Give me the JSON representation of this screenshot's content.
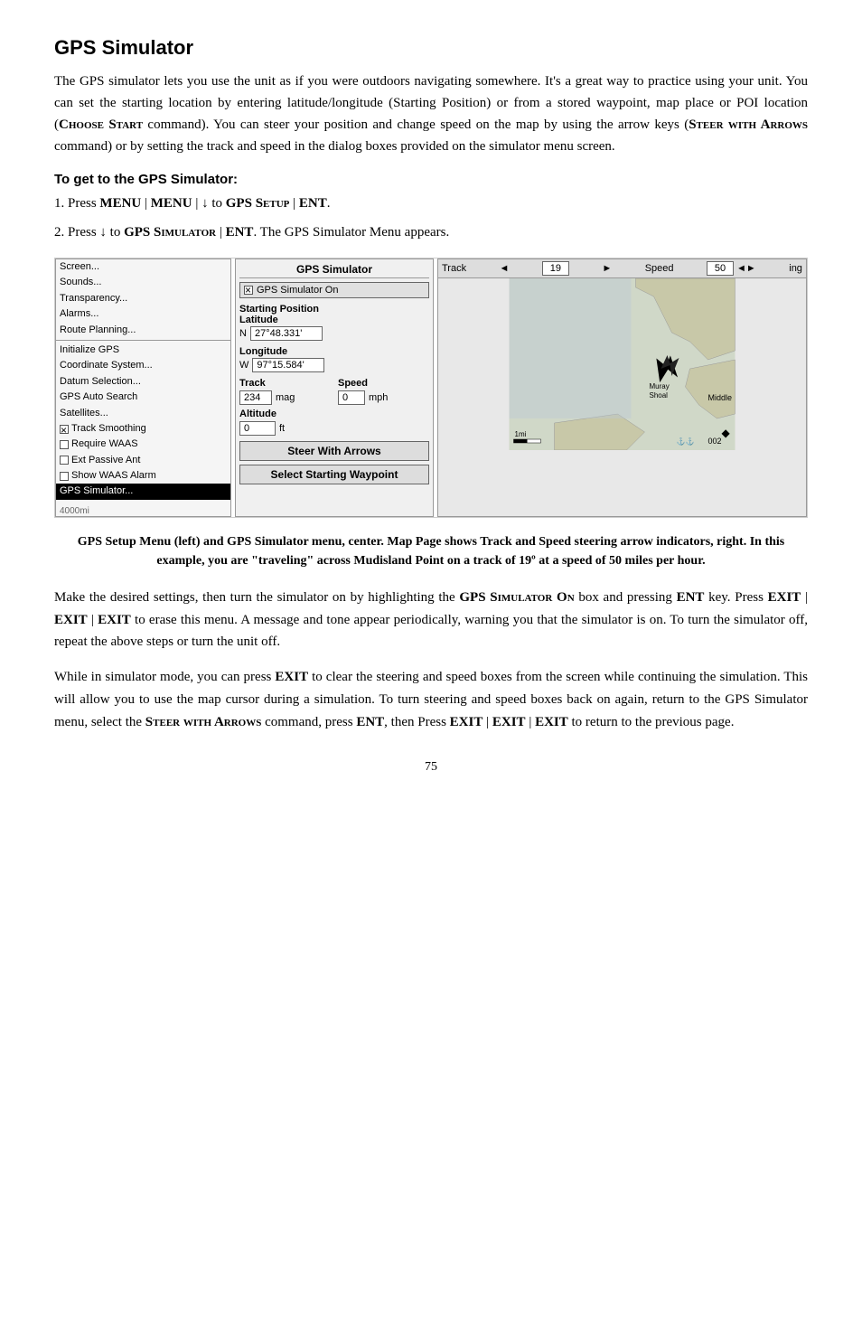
{
  "page": {
    "title": "GPS Simulator",
    "intro": "The GPS simulator lets you use the unit as if you were outdoors navigating somewhere. It's a great way to practice using your unit. You can set the starting location by entering latitude/longitude (Starting Position) or from a stored waypoint, map place or POI location (",
    "intro_small_caps": "Choose Start",
    "intro_cont": " command). You can steer your position and change speed on the map by using the arrow keys (",
    "intro_bold": "Steer with Arrows",
    "intro_cont2": " command) or by setting the track and speed in the dialog boxes provided on the simulator menu screen.",
    "section_heading": "To get to the GPS Simulator:",
    "step1": "1. Press ",
    "step1_bold": "MENU",
    "step1_sep": " | ",
    "step1_bold2": "MENU",
    "step1_sep2": " | ↓ to ",
    "step1_bold3": "GPS S",
    "step1_small": "ETUP",
    "step1_sep3": " | ",
    "step1_bold4": "ENT",
    "step1_end": ".",
    "step2": "2. Press ↓ to ",
    "step2_bold": "GPS S",
    "step2_small": "IMULATOR",
    "step2_sep": " | ",
    "step2_bold2": "ENT",
    "step2_end": ". The GPS Simulator Menu appears.",
    "caption": "GPS Setup Menu (left) and GPS Simulator menu, center. Map Page shows Track and Speed steering arrow indicators, right. In this example, you are \"traveling\" across Mudisland Point on a track of 19º at a speed of 50 miles per hour.",
    "body1_part1": "Make the desired settings, then turn the simulator on by highlighting the ",
    "body1_bold": "GPS S",
    "body1_small": "IMULATOR",
    "body1_bold2": " O",
    "body1_small2": "N",
    "body1_cont": " box and pressing ",
    "body1_ent": "ENT",
    "body1_cont2": " key. Press ",
    "body1_exit1": "EXIT",
    "body1_sep1": " | ",
    "body1_exit2": "EXIT",
    "body1_sep2": " | ",
    "body1_exit3": "EXIT",
    "body1_cont3": " to erase this menu. A message and tone appear periodically, warning you that the simulator is on. To turn the simulator off, repeat the above steps or turn the unit off.",
    "body2_part1": "While in simulator mode, you can press ",
    "body2_exit": "EXIT",
    "body2_cont": " to clear the steering and speed boxes from the screen while continuing the simulation. This will allow you to use the map cursor during a simulation. To turn steering and speed boxes back on again, return to the GPS Simulator menu, select the ",
    "body2_small": "Steer with Arrows",
    "body2_cont2": " command, press ",
    "body2_ent": "ENT",
    "body2_cont3": ", then Press ",
    "body2_exit2": "EXIT",
    "body2_sep1": " | ",
    "body2_exit3": "EXIT",
    "body2_sep2": " | ",
    "body2_exit4": "EXIT",
    "body2_cont4": " to return to the previous page.",
    "page_number": "75"
  },
  "left_menu": {
    "items": [
      {
        "label": "Screen...",
        "highlight": false,
        "type": "normal"
      },
      {
        "label": "Sounds...",
        "highlight": false,
        "type": "normal"
      },
      {
        "label": "Transparency...",
        "highlight": false,
        "type": "normal"
      },
      {
        "label": "Alarms...",
        "highlight": false,
        "type": "normal"
      },
      {
        "label": "Route Planning...",
        "highlight": false,
        "type": "normal"
      },
      {
        "label": "divider",
        "type": "divider"
      },
      {
        "label": "Initialize GPS",
        "highlight": false,
        "type": "normal"
      },
      {
        "label": "Coordinate System...",
        "highlight": false,
        "type": "normal"
      },
      {
        "label": "Datum Selection...",
        "highlight": false,
        "type": "normal"
      },
      {
        "label": "GPS Auto Search",
        "highlight": false,
        "type": "normal"
      },
      {
        "label": "Satellites...",
        "highlight": false,
        "type": "normal"
      },
      {
        "label": "Track Smoothing",
        "highlight": false,
        "type": "checkbox",
        "checked": true
      },
      {
        "label": "Require WAAS",
        "highlight": false,
        "type": "checkbox",
        "checked": false
      },
      {
        "label": "Ext Passive Ant",
        "highlight": false,
        "type": "checkbox",
        "checked": false
      },
      {
        "label": "Show WAAS Alarm",
        "highlight": false,
        "type": "checkbox",
        "checked": false
      },
      {
        "label": "GPS Simulator...",
        "highlight": true,
        "type": "normal"
      }
    ],
    "bottom": "4000mi"
  },
  "center_panel": {
    "title": "GPS Simulator",
    "gps_on_label": "GPS Simulator On",
    "gps_on_checked": true,
    "starting_position": "Starting Position",
    "latitude_label": "Latitude",
    "latitude_prefix": "N",
    "latitude_value": "27°48.331'",
    "longitude_label": "Longitude",
    "longitude_prefix": "W",
    "longitude_value": "97°15.584'",
    "track_label": "Track",
    "speed_label": "Speed",
    "track_value": "234",
    "track_unit": "mag",
    "speed_value": "0",
    "speed_unit": "mph",
    "altitude_label": "Altitude",
    "altitude_value": "0",
    "altitude_unit": "ft",
    "steer_btn": "Steer With Arrows",
    "waypoint_btn": "Select Starting Waypoint"
  },
  "right_panel": {
    "track_label": "Track",
    "speed_label": "Speed",
    "heading_label": "ing",
    "track_value": "19",
    "speed_value": "50",
    "map_label_muray": "Muray",
    "map_label_shoal": "Shoal",
    "map_label_middle": "Middle",
    "map_label_1mi": "1mi",
    "map_label_002": "002"
  }
}
